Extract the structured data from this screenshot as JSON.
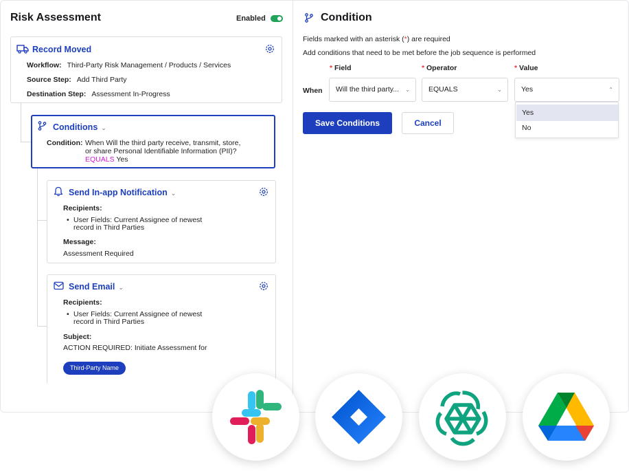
{
  "left_panel": {
    "title": "Risk Assessment",
    "enabled_label": "Enabled",
    "enabled": true,
    "record_card": {
      "title": "Record Moved",
      "workflow_label": "Workflow:",
      "workflow_value": "Third-Party Risk Management  / Products / Services",
      "source_label": "Source Step:",
      "source_value": "Add Third Party",
      "dest_label": "Destination Step:",
      "dest_value": "Assessment In-Progress"
    },
    "conditions_card": {
      "title": "Conditions",
      "condition_label": "Condition:",
      "condition_line1": "When Will the third party receive, transmit, store,",
      "condition_line2": "or share Personal Identifiable Information (PII)?",
      "operator": "EQUALS",
      "value": "Yes"
    },
    "notification_card": {
      "title": "Send In-app Notification",
      "recipients_label": "Recipients:",
      "recipient_line1": "User Fields: Current Assignee of newest",
      "recipient_line2": "record in Third Parties",
      "message_label": "Message:",
      "message_value": "Assessment Required"
    },
    "email_card": {
      "title": "Send Email",
      "recipients_label": "Recipients:",
      "recipient_line1": "User Fields: Current Assignee of newest",
      "recipient_line2": "record in Third Parties",
      "subject_label": "Subject:",
      "subject_value": "ACTION REQUIRED: Initiate Assessment for",
      "pill": "Third-Party Name"
    }
  },
  "right_panel": {
    "title": "Condition",
    "required_note_prefix": "Fields marked with an asterisk (",
    "required_note_asterisk": "*",
    "required_note_suffix": ") are required",
    "instructions": "Add conditions that need to be met before the job sequence is performed",
    "columns": {
      "field": "Field",
      "operator": "Operator",
      "value": "Value"
    },
    "asterisk": "*",
    "when_label": "When",
    "field_value": "Will the third party...",
    "operator_value": "EQUALS",
    "value_value": "Yes",
    "value_options": [
      "Yes",
      "No"
    ],
    "selected_option": "Yes",
    "save_button": "Save Conditions",
    "cancel_button": "Cancel"
  },
  "apps": [
    "slack-icon",
    "jira-icon",
    "openai-icon",
    "google-drive-icon"
  ],
  "colors": {
    "accent": "#1d3fbd",
    "toggle_on": "#21a35a",
    "operator_magenta": "#d21ad8",
    "required_red": "#e23b3b"
  }
}
